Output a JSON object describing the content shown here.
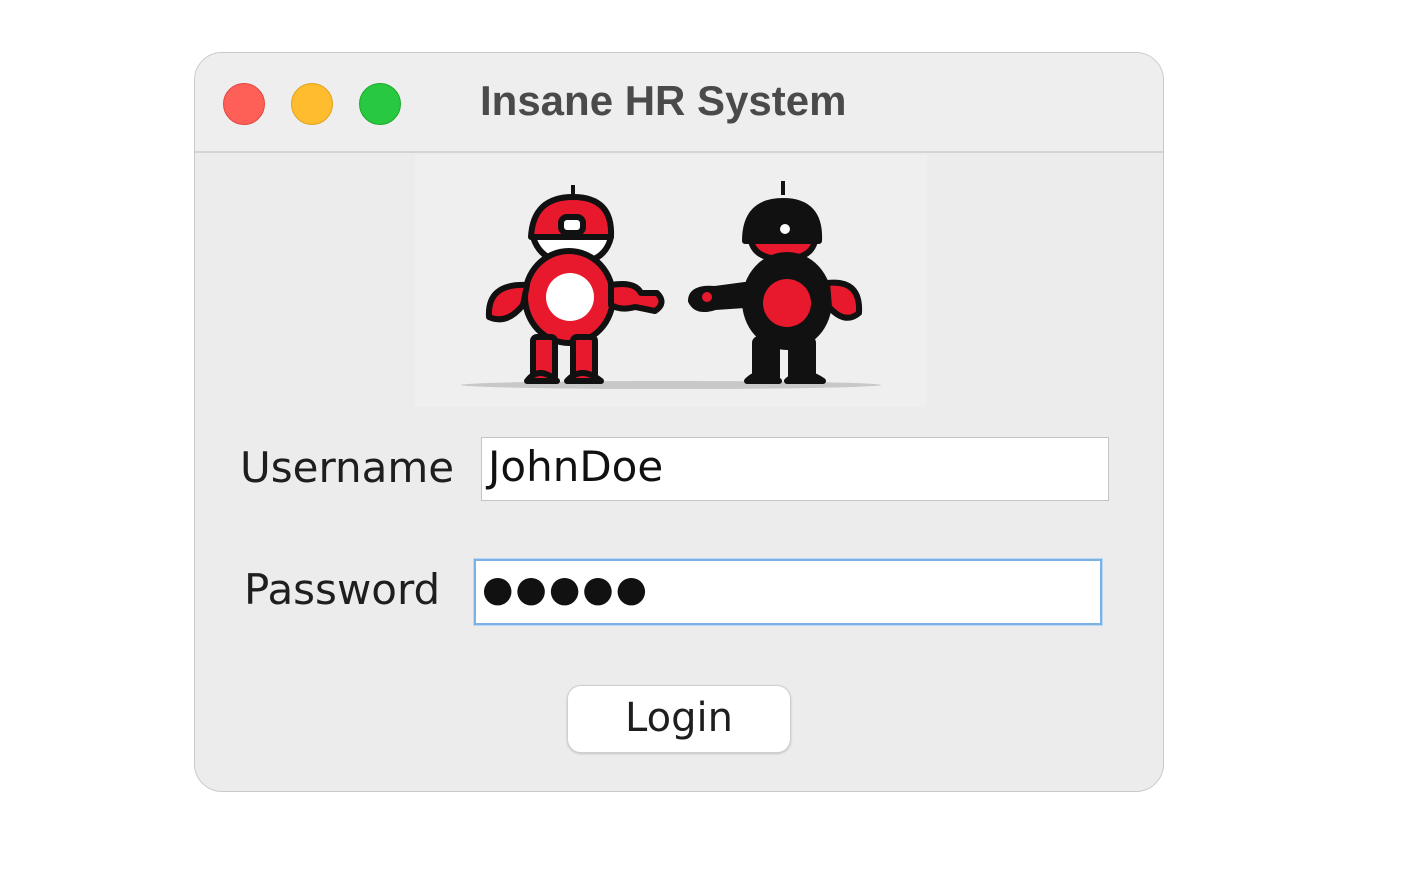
{
  "window": {
    "title": "Insane HR System",
    "controls": [
      "close",
      "minimize",
      "zoom"
    ]
  },
  "logo": {
    "icon": "two-robots-logo",
    "colors": {
      "red": "#e8192c",
      "black": "#111111"
    }
  },
  "form": {
    "username_label": "Username",
    "username_value": "JohnDoe",
    "password_label": "Password",
    "password_mask": "●●●●●",
    "login_label": "Login"
  },
  "colors": {
    "close": "#fe5f57",
    "minimize": "#febc2e",
    "zoom": "#28c840",
    "focus_ring": "#7cb1e3"
  }
}
